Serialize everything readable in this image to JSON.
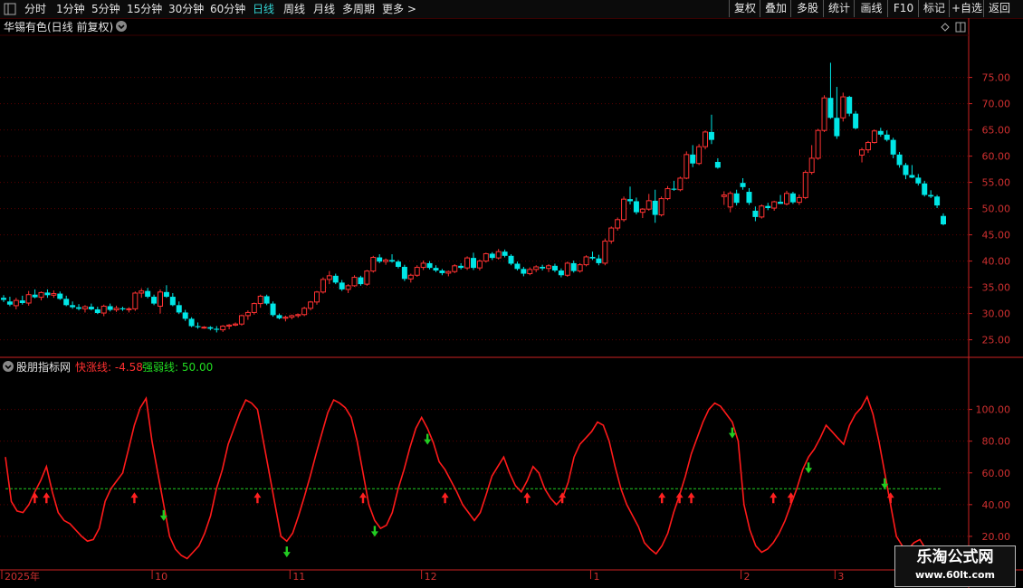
{
  "toolbar": {
    "periods": [
      "分时",
      "1分钟",
      "5分钟",
      "15分钟",
      "30分钟",
      "60分钟",
      "日线",
      "周线",
      "月线",
      "多周期",
      "更多 >"
    ],
    "active_period": "日线",
    "buttons": [
      "复权",
      "叠加",
      "多股",
      "统计",
      "画线",
      "F10",
      "标记",
      "+自选",
      "返回"
    ]
  },
  "chart_title": "华锡有色(日线 前复权)",
  "indicator": {
    "name": "股朋指标网",
    "fast_label": "快涨线: -4.58",
    "strong_label": "强弱线: 50.00"
  },
  "watermark": {
    "line1": "乐淘公式网",
    "line2": "www.60lt.com"
  },
  "colors": {
    "up": "#ff3232",
    "down": "#00e6e6",
    "fast": "#ff1a1a",
    "strong": "#22cc22",
    "grid": "#5a0000",
    "axis": "#cc2222"
  },
  "chart_data": [
    {
      "type": "candlestick",
      "title": "华锡有色(日线 前复权)",
      "ylim": [
        22,
        82
      ],
      "y_ticks": [
        "25.00",
        "30.00",
        "35.00",
        "40.00",
        "45.00",
        "50.00",
        "55.00",
        "60.00",
        "65.00",
        "70.00",
        "75.00"
      ],
      "x_ticks": [
        "2025年",
        "10",
        "11",
        "12",
        "1",
        "2",
        "3"
      ],
      "ohlc": [
        [
          33,
          33.5,
          32.2,
          32.6
        ],
        [
          32.3,
          33.2,
          31.4,
          31.7
        ],
        [
          31.5,
          33,
          30.8,
          32.5
        ],
        [
          32.5,
          33.4,
          31.7,
          32
        ],
        [
          32,
          34.3,
          31.5,
          33.6
        ],
        [
          33.6,
          34.6,
          32.9,
          33.1
        ],
        [
          33.1,
          34.2,
          32.5,
          34
        ],
        [
          34,
          34.6,
          33,
          33.5
        ],
        [
          33.5,
          34.4,
          33,
          33.8
        ],
        [
          33.8,
          34.2,
          32.6,
          32.8
        ],
        [
          32.8,
          33.4,
          31.4,
          31.6
        ],
        [
          31.6,
          32.3,
          30.9,
          31.2
        ],
        [
          31.2,
          31.8,
          30.6,
          30.9
        ],
        [
          30.9,
          31.6,
          30.2,
          31.3
        ],
        [
          31.3,
          31.9,
          30.6,
          30.8
        ],
        [
          30.8,
          31.3,
          29.9,
          30.1
        ],
        [
          30.1,
          31.7,
          29.5,
          31.4
        ],
        [
          31.4,
          31.9,
          30.4,
          30.7
        ],
        [
          30.7,
          31.5,
          30.3,
          31
        ],
        [
          31,
          31.3,
          30.5,
          30.8
        ],
        [
          30.8,
          31.2,
          30.2,
          30.9
        ],
        [
          30.9,
          34.2,
          30.5,
          33.9
        ],
        [
          33.9,
          34.8,
          33,
          34.3
        ],
        [
          34.3,
          34.9,
          32.9,
          33.2
        ],
        [
          33.2,
          33.6,
          31.6,
          31.9
        ],
        [
          31.4,
          34.6,
          30,
          34.1
        ],
        [
          34.1,
          35.4,
          33,
          33.2
        ],
        [
          33.2,
          33.9,
          31.4,
          31.6
        ],
        [
          31.6,
          32.3,
          29.9,
          30.2
        ],
        [
          30.2,
          30.7,
          28.6,
          29
        ],
        [
          29,
          29.3,
          27.4,
          27.6
        ],
        [
          27.6,
          28.3,
          27.1,
          27.4
        ],
        [
          27.4,
          27.6,
          27.1,
          27.4
        ],
        [
          27.4,
          27.6,
          26.8,
          27.1
        ],
        [
          27.1,
          27.6,
          26.4,
          26.9
        ],
        [
          26.9,
          27.8,
          26.5,
          27.6
        ],
        [
          27.6,
          28,
          27,
          27.8
        ],
        [
          27.8,
          28.3,
          27.6,
          28
        ],
        [
          28,
          29.8,
          27.7,
          29.6
        ],
        [
          29.6,
          30.6,
          28.8,
          30.2
        ],
        [
          30.2,
          32.1,
          29.8,
          31.9
        ],
        [
          31.9,
          33.6,
          31.1,
          33.3
        ],
        [
          33.3,
          33.6,
          31.6,
          31.9
        ],
        [
          31.9,
          32.3,
          29.4,
          29.7
        ],
        [
          29.7,
          30,
          28.9,
          29.1
        ],
        [
          29.1,
          29.6,
          28.5,
          29.3
        ],
        [
          29.3,
          29.8,
          28.9,
          29.6
        ],
        [
          29.6,
          30,
          29.2,
          29.8
        ],
        [
          29.8,
          31.3,
          29.5,
          31
        ],
        [
          31,
          32.4,
          30.6,
          32.2
        ],
        [
          32.2,
          34.3,
          31.7,
          34.1
        ],
        [
          34.1,
          36.9,
          33.8,
          36.5
        ],
        [
          36.5,
          38.1,
          35.6,
          37.2
        ],
        [
          37.2,
          37.6,
          35.6,
          35.9
        ],
        [
          35.9,
          36.4,
          34.3,
          34.6
        ],
        [
          34.6,
          35.6,
          33.9,
          35.3
        ],
        [
          35.3,
          37.3,
          35.1,
          36.9
        ],
        [
          36.9,
          37.2,
          35.3,
          35.6
        ],
        [
          35.6,
          38.3,
          35.3,
          38.1
        ],
        [
          38.1,
          41,
          37.8,
          40.7
        ],
        [
          40.7,
          41.3,
          39.6,
          39.9
        ],
        [
          39.9,
          40.5,
          39.3,
          40.2
        ],
        [
          40.2,
          41.3,
          39.7,
          39.9
        ],
        [
          39.9,
          40.2,
          38.6,
          38.9
        ],
        [
          38.9,
          39.3,
          36.2,
          36.6
        ],
        [
          36.6,
          37.6,
          35.9,
          37.3
        ],
        [
          37.3,
          39.2,
          37,
          38.8
        ],
        [
          38.8,
          40.1,
          38.3,
          39.6
        ],
        [
          39.6,
          40,
          38.4,
          38.7
        ],
        [
          38.7,
          39.2,
          37.9,
          38.2
        ],
        [
          38.2,
          38.5,
          37.3,
          37.7
        ],
        [
          37.7,
          38.2,
          37.1,
          38
        ],
        [
          38,
          39.4,
          37.7,
          39.1
        ],
        [
          39.1,
          39.6,
          38.4,
          38.7
        ],
        [
          38.7,
          40.9,
          38.3,
          40.6
        ],
        [
          40.6,
          41.6,
          38.3,
          38.7
        ],
        [
          38.7,
          40.3,
          38.2,
          40
        ],
        [
          40,
          41.6,
          39.7,
          41.4
        ],
        [
          41.4,
          41.7,
          40.2,
          40.6
        ],
        [
          40.6,
          42.3,
          40.3,
          41.8
        ],
        [
          41.8,
          42.2,
          40.7,
          41
        ],
        [
          41,
          41.3,
          39.2,
          39.5
        ],
        [
          39.5,
          39.9,
          38.2,
          38.5
        ],
        [
          38.5,
          38.9,
          37.1,
          37.6
        ],
        [
          37.6,
          38.8,
          37.3,
          38.4
        ],
        [
          38.4,
          39.2,
          37.9,
          38.9
        ],
        [
          38.9,
          39.3,
          38.2,
          38.6
        ],
        [
          38.6,
          39.4,
          37.9,
          39.1
        ],
        [
          39.1,
          39.5,
          37.9,
          38.2
        ],
        [
          38.2,
          38.6,
          36.9,
          37.3
        ],
        [
          37.3,
          39.9,
          37,
          39.6
        ],
        [
          39.6,
          40.1,
          37.8,
          38.1
        ],
        [
          38.1,
          39.6,
          37.8,
          39.3
        ],
        [
          39.3,
          41.1,
          39,
          40.8
        ],
        [
          40.8,
          41.8,
          40.2,
          40.5
        ],
        [
          40.5,
          41.2,
          39.2,
          39.6
        ],
        [
          39.6,
          44.3,
          39.2,
          43.8
        ],
        [
          43.8,
          46.6,
          43.3,
          46.3
        ],
        [
          46.3,
          48.3,
          45.8,
          47.9
        ],
        [
          47.9,
          52.3,
          47.5,
          51.8
        ],
        [
          51.8,
          54.2,
          50.8,
          51.4
        ],
        [
          51.4,
          52.1,
          48.9,
          49.3
        ],
        [
          49.3,
          50.1,
          48.2,
          49.9
        ],
        [
          49.9,
          52.8,
          49.6,
          51.5
        ],
        [
          51.5,
          53.6,
          47.3,
          48.8
        ],
        [
          48.8,
          52.3,
          48.5,
          51.9
        ],
        [
          51.9,
          54.3,
          51.6,
          53.8
        ],
        [
          53.8,
          55.3,
          53.4,
          53.6
        ],
        [
          53.6,
          56.1,
          53.3,
          55.8
        ],
        [
          55.8,
          60.9,
          55.6,
          60.3
        ],
        [
          60.3,
          62.1,
          57.9,
          58.6
        ],
        [
          58.6,
          62.3,
          58.3,
          61.8
        ],
        [
          61.8,
          64.9,
          61.3,
          64.6
        ],
        [
          64.6,
          67.9,
          62.3,
          63.1
        ],
        [
          58.9,
          59.6,
          57.6,
          57.8
        ],
        [
          52.3,
          53.3,
          50.7,
          52.6
        ],
        [
          50.3,
          53.3,
          49.3,
          52.9
        ],
        [
          52.9,
          53.6,
          50.6,
          51.1
        ],
        [
          54.9,
          55.8,
          53.6,
          54.1
        ],
        [
          53.2,
          53.9,
          50.7,
          51.1
        ],
        [
          49.6,
          50.4,
          47.6,
          48.4
        ],
        [
          48.4,
          50.8,
          48.1,
          50.5
        ],
        [
          50.5,
          51.1,
          49.7,
          50.1
        ],
        [
          50.1,
          51.5,
          49.6,
          51.3
        ],
        [
          51.3,
          52.6,
          50.9,
          50.9
        ],
        [
          50.9,
          53.4,
          50.6,
          52.9
        ],
        [
          52.9,
          53.2,
          50.9,
          51.2
        ],
        [
          51.2,
          52.7,
          50.7,
          52.1
        ],
        [
          52.1,
          57.3,
          51.8,
          56.9
        ],
        [
          56.9,
          62.1,
          56.5,
          59.6
        ],
        [
          59.6,
          65.2,
          59.3,
          64.9
        ],
        [
          64.9,
          71.6,
          64.6,
          71.1
        ],
        [
          71.1,
          77.8,
          67.1,
          67.3
        ],
        [
          67.3,
          73.2,
          63.3,
          63.8
        ],
        [
          67.3,
          72.1,
          66.6,
          71.3
        ],
        [
          71.3,
          71.5,
          67.6,
          68.1
        ],
        [
          68.1,
          68.6,
          65.1,
          65.3
        ],
        [
          60.2,
          61.6,
          58.8,
          61.2
        ],
        [
          61.2,
          62.9,
          60.6,
          62.6
        ],
        [
          62.6,
          65.1,
          62.4,
          64.8
        ],
        [
          64.8,
          65.4,
          63.7,
          64.1
        ],
        [
          64.1,
          64.9,
          62.8,
          63.1
        ],
        [
          63.1,
          63.5,
          59.6,
          60.3
        ],
        [
          60.3,
          60.8,
          57.8,
          58.3
        ],
        [
          58.3,
          58.7,
          55.6,
          56.4
        ],
        [
          56.4,
          58.3,
          55.8,
          55.9
        ],
        [
          55.9,
          56.6,
          54.4,
          54.8
        ],
        [
          54.8,
          55.3,
          52.3,
          52.6
        ],
        [
          52.6,
          53.5,
          52,
          52.3
        ],
        [
          52.3,
          52.6,
          50.1,
          50.6
        ],
        [
          48.6,
          49.1,
          46.8,
          47
        ]
      ]
    },
    {
      "type": "line",
      "ylim": [
        0,
        122
      ],
      "y_ticks": [
        "20.00",
        "40.00",
        "60.00",
        "80.00",
        "100.00"
      ],
      "reference_line": 50,
      "series": [
        {
          "name": "快涨线",
          "values": [
            70,
            42,
            36,
            35,
            40,
            48,
            55,
            64,
            48,
            35,
            30,
            28,
            24,
            20,
            17,
            18,
            25,
            42,
            50,
            55,
            60,
            75,
            90,
            101,
            107,
            80,
            60,
            40,
            20,
            12,
            8,
            6,
            10,
            14,
            22,
            33,
            50,
            62,
            78,
            88,
            98,
            106,
            104,
            100,
            80,
            60,
            40,
            20,
            17,
            22,
            33,
            45,
            58,
            72,
            85,
            98,
            106,
            104,
            101,
            95,
            80,
            60,
            40,
            30,
            25,
            27,
            35,
            50,
            62,
            76,
            88,
            95,
            88,
            79,
            67,
            62,
            55,
            48,
            40,
            35,
            30,
            35,
            46,
            58,
            64,
            70,
            60,
            52,
            48,
            55,
            64,
            60,
            50,
            44,
            40,
            44,
            54,
            70,
            78,
            82,
            86,
            92,
            90,
            80,
            64,
            50,
            40,
            33,
            26,
            16,
            12,
            9,
            14,
            22,
            35,
            46,
            58,
            72,
            82,
            92,
            100,
            104,
            102,
            97,
            92,
            80,
            40,
            24,
            14,
            10,
            12,
            16,
            22,
            30,
            40,
            50,
            62,
            70,
            75,
            82,
            90,
            86,
            82,
            78,
            90,
            97,
            101,
            108,
            97,
            80,
            60,
            40,
            20,
            14,
            12,
            16,
            18,
            12,
            9,
            8,
            9
          ]
        },
        {
          "name": "强弱线",
          "values": [
            50
          ]
        }
      ],
      "buy_indices": [
        5,
        7,
        22,
        43,
        61,
        75,
        89,
        95,
        112,
        115,
        117,
        131,
        134,
        151
      ],
      "sell_indices": [
        27,
        48,
        63,
        72,
        124,
        137,
        150,
        153,
        157,
        162
      ]
    }
  ]
}
